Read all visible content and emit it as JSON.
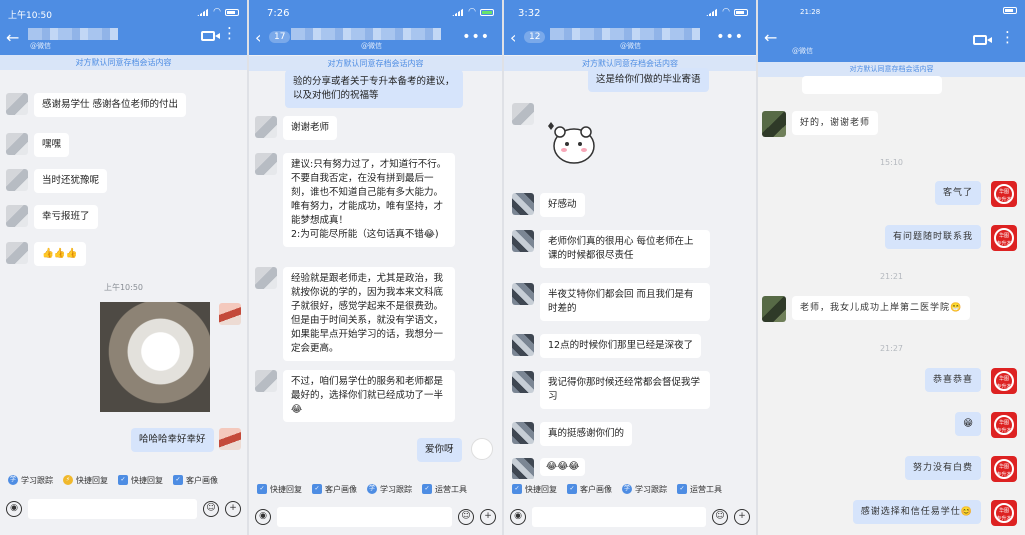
{
  "panel1": {
    "status_time": "上午10:50",
    "notice": "对方默认同意存档会话内容",
    "sub_name": "@微信",
    "messages": [
      "感谢易学仕 感谢各位老师的付出",
      "嘿嘿",
      "当时还犹豫呢",
      "幸亏报班了",
      "👍👍👍"
    ],
    "time_label": "上午10:50",
    "my_message": "哈哈哈幸好幸好",
    "quick": [
      "学习跟踪",
      "快捷回复",
      "快捷回复",
      "客户画像"
    ]
  },
  "panel2": {
    "status_time": "7:26",
    "badge": "17",
    "sub_name": "@微信",
    "notice": "对方默认同意存档会话内容",
    "top_message": "验的分享或者关于专升本备考的建议，以及对他们的祝福等",
    "messages": [
      "谢谢老师",
      "建议:只有努力过了，才知道行不行。不要自我否定，在没有拼到最后一刻，谁也不知道自己能有多大能力。唯有努力，才能成功，唯有坚持，才能梦想成真！\n2:为可能尽所能（这句话真不错😂)",
      "经验就是跟老师走，尤其是政治，我就按你说的学的，因为我本来文科底子就很好，感觉学起来不是很费劲。但是由于时间关系，就没有学语文，如果能早点开始学习的话，我想分一定会更高。",
      "不过，咱们易学仕的服务和老师都是最好的，选择你们就已经成功了一半😂"
    ],
    "my_message": "爱你呀",
    "quick": [
      "快捷回复",
      "客户画像",
      "学习跟踪",
      "运营工具"
    ]
  },
  "panel3": {
    "status_time": "3:32",
    "badge": "12",
    "sub_name": "@微信",
    "notice": "对方默认同意存档会话内容",
    "top_message": "这是给你们做的毕业寄语",
    "messages": [
      "好感动",
      "老师你们真的很用心 每位老师在上课的时候都很尽责任",
      "半夜艾特你们都会回 而且我们是有时差的",
      "12点的时候你们那里已经是深夜了",
      "我记得你那时候还经常都会督促我学习",
      "真的挺感谢你们的",
      "😂😂😂"
    ],
    "quick": [
      "快捷回复",
      "客户画像",
      "学习跟踪",
      "运营工具"
    ]
  },
  "panel4": {
    "status_time": "21:28",
    "sub_name": "@微信",
    "notice": "对方默认同意存档会话内容",
    "times": [
      "15:10",
      "21:21",
      "21:27"
    ],
    "their_messages": [
      "好的，谢谢老师",
      "老师，我女儿成功上岸第二医学院😁"
    ],
    "my_messages": [
      "客气了",
      "有问题随时联系我",
      "恭喜恭喜",
      "😁",
      "努力没有白费",
      "感谢选择和信任易学仕😊"
    ],
    "logo_text": "华图 专升本"
  },
  "colors": {
    "header": "#4e8de3",
    "my_bubble": "#d6e4fb",
    "notice_bg": "#d9e5f8"
  }
}
